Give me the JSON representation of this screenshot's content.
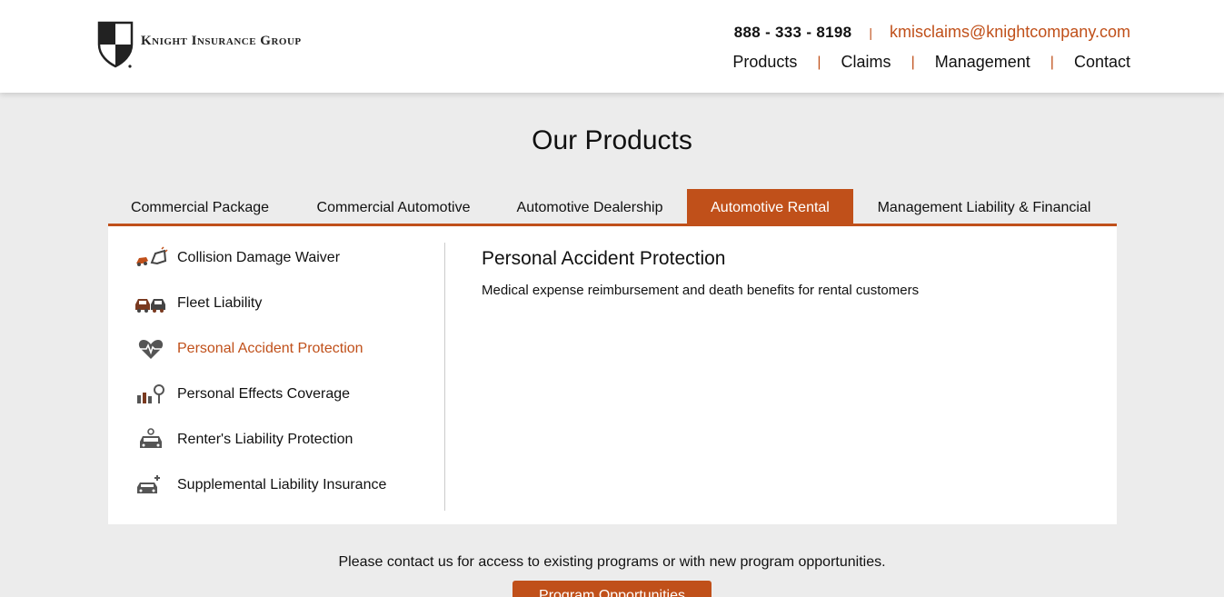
{
  "brand": {
    "name": "Knight Insurance Group",
    "accent_color": "#c0501a"
  },
  "header": {
    "phone": "888 - 333 - 8198",
    "email": "kmisclaims@knightcompany.com",
    "nav": [
      "Products",
      "Claims",
      "Management",
      "Contact"
    ]
  },
  "main": {
    "title": "Our Products",
    "tabs": [
      {
        "label": "Commercial Package",
        "active": false
      },
      {
        "label": "Commercial Automotive",
        "active": false
      },
      {
        "label": "Automotive Dealership",
        "active": false
      },
      {
        "label": "Automotive Rental",
        "active": true
      },
      {
        "label": "Management Liability & Financial",
        "active": false
      }
    ],
    "products": [
      {
        "label": "Collision Damage Waiver",
        "icon": "car-crash-icon",
        "active": false
      },
      {
        "label": "Fleet Liability",
        "icon": "cars-icon",
        "active": false
      },
      {
        "label": "Personal Accident Protection",
        "icon": "heartbeat-icon",
        "active": true
      },
      {
        "label": "Personal Effects Coverage",
        "icon": "personal-items-icon",
        "active": false
      },
      {
        "label": "Renter's Liability Protection",
        "icon": "car-user-icon",
        "active": false
      },
      {
        "label": "Supplemental Liability Insurance",
        "icon": "car-plus-icon",
        "active": false
      }
    ],
    "detail": {
      "title": "Personal Accident Protection",
      "description": "Medical expense reimbursement and death benefits for rental customers"
    }
  },
  "footer": {
    "cta_text": "Please contact us for access to existing programs or with new program opportunities.",
    "cta_button": "Program Opportunities"
  }
}
